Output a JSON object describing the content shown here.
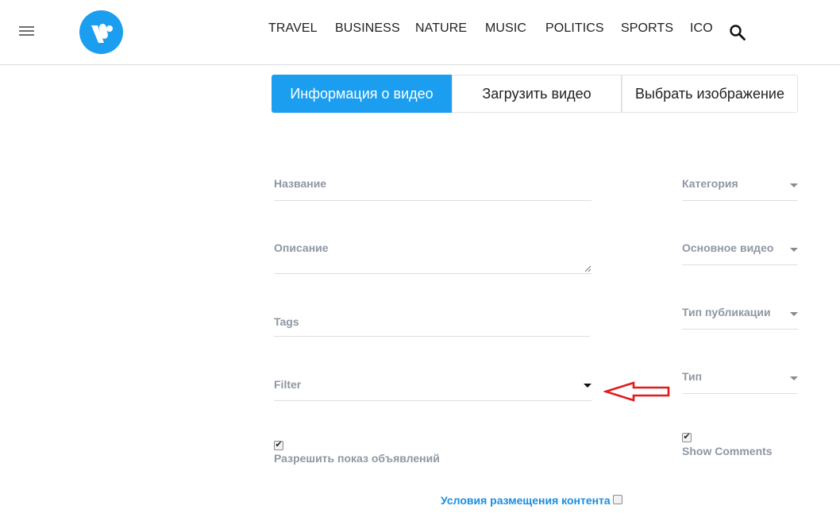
{
  "nav": {
    "items": [
      "TRAVEL",
      "BUSINESS",
      "NATURE",
      "MUSIC",
      "POLITICS",
      "SPORTS",
      "ICO"
    ]
  },
  "icons": {
    "menu": "hamburger-menu-icon",
    "logo": "v-logo-icon",
    "search": "search-icon",
    "dropdown": "caret-down-icon"
  },
  "tabs": {
    "info": "Информация о видео",
    "upload": "Загрузить видео",
    "image": "Выбрать изображение"
  },
  "form": {
    "title_label": "Название",
    "description_label": "Описание",
    "tags_label": "Tags",
    "filter_label": "Filter",
    "category_label": "Категория",
    "main_video_label": "Основное видео",
    "publication_type_label": "Тип публикации",
    "type_label": "Тип",
    "allow_ads_label": "Разрешить показ объявлений",
    "allow_ads_checked": true,
    "show_comments_label": "Show Comments",
    "show_comments_checked": true,
    "terms_label": "Условия размещения контента",
    "terms_checked": false
  },
  "colors": {
    "accent": "#1b9ef0",
    "label": "#8f97a3",
    "link": "#1b8ee0",
    "annotation": "#e01b1b"
  }
}
